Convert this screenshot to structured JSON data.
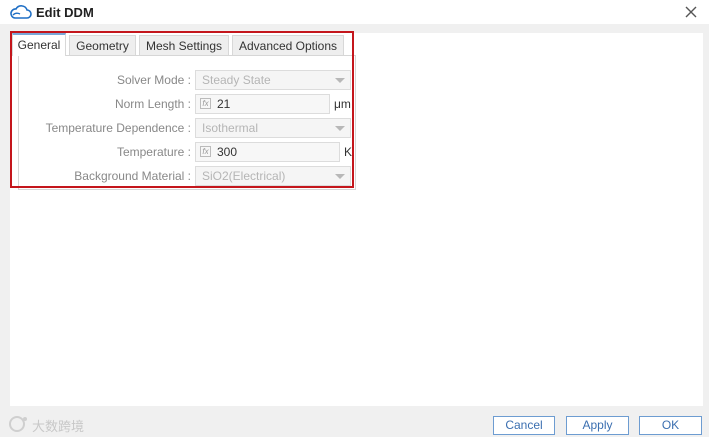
{
  "window": {
    "title": "Edit DDM"
  },
  "tabs": [
    "General",
    "Geometry",
    "Mesh Settings",
    "Advanced Options"
  ],
  "form": {
    "solver_mode": {
      "label": "Solver Mode :",
      "value": "Steady State"
    },
    "norm_length": {
      "label": "Norm Length :",
      "value": "21",
      "unit": "μm"
    },
    "temperature_dependence": {
      "label": "Temperature Dependence :",
      "value": "Isothermal"
    },
    "temperature": {
      "label": "Temperature :",
      "value": "300",
      "unit": "K"
    },
    "background_material": {
      "label": "Background Material :",
      "value": "SiO2(Electrical)"
    }
  },
  "buttons": {
    "cancel": "Cancel",
    "apply": "Apply",
    "ok": "OK"
  },
  "watermark": {
    "text": "大数跨境"
  },
  "colors": {
    "highlight": "#c4161c",
    "button_border": "#6d9cd1",
    "button_text": "#3b6fb0"
  }
}
